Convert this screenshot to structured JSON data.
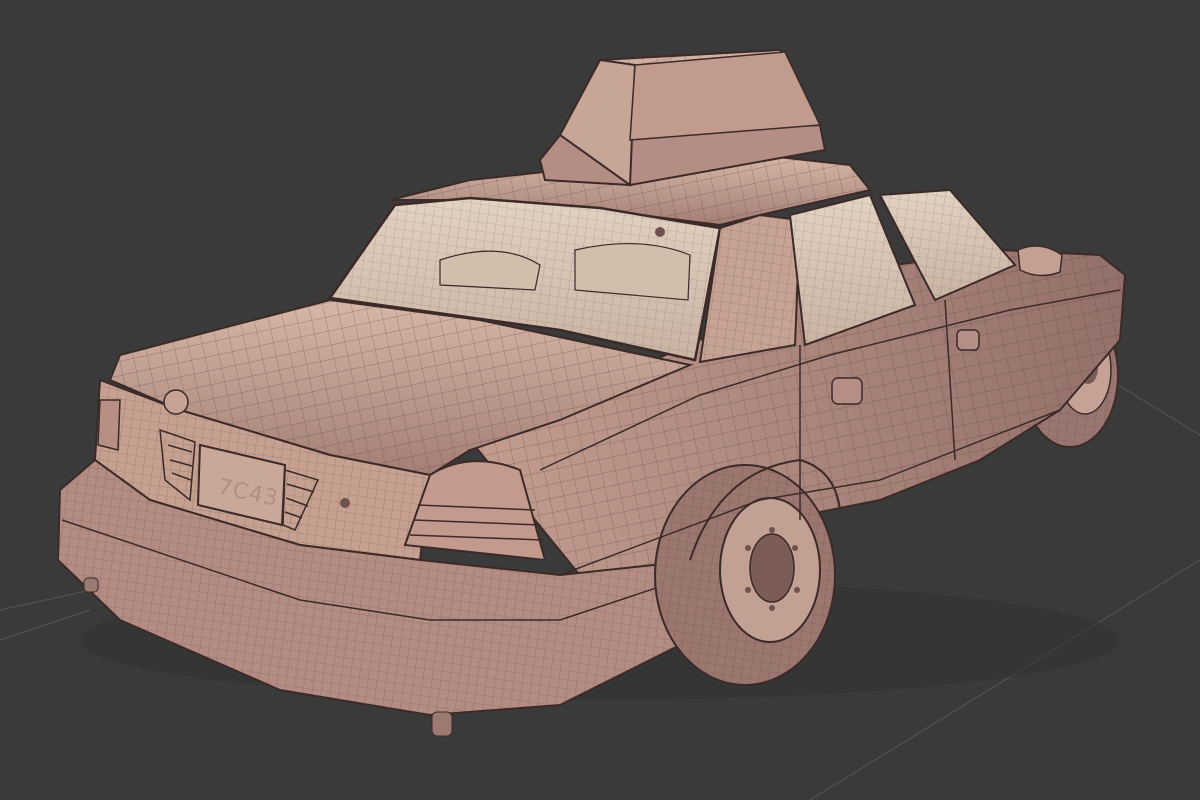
{
  "scene": {
    "subject": "taxi-sedan-wireframe",
    "plate_text": "7C43",
    "colors": {
      "background": "#3a3a3a",
      "body": "#b89088",
      "body_light": "#cfae9f",
      "body_dark": "#8f6a64",
      "glass": "#d8c6b2",
      "wire": "#3c2a28",
      "grid_line": "#5a5a5a"
    }
  }
}
